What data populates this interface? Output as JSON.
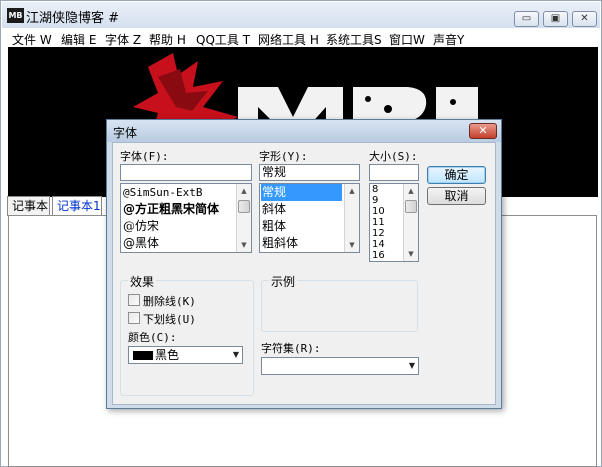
{
  "window": {
    "title": "江湖侠隐博客 #",
    "icon_label": "MB"
  },
  "menu": {
    "items": [
      {
        "label": "文件 W"
      },
      {
        "label": "编辑 E"
      },
      {
        "label": "字体 Z"
      },
      {
        "label": "帮助 H"
      },
      {
        "label": "QQ工具 T"
      },
      {
        "label": "网络工具 H"
      },
      {
        "label": "系统工具S"
      },
      {
        "label": "窗口W"
      },
      {
        "label": "声音Y"
      }
    ]
  },
  "tabs": [
    {
      "label": "记事本"
    },
    {
      "label": "记事本1",
      "active": true
    }
  ],
  "dialog": {
    "title": "字体",
    "font_label": "字体(F):",
    "font_value": "",
    "font_list": [
      "@SimSun-ExtB",
      "@方正粗黑宋简体",
      "@仿宋",
      "@黑体"
    ],
    "style_label": "字形(Y):",
    "style_value": "常规",
    "style_list": [
      "常规",
      "斜体",
      "粗体",
      "粗斜体"
    ],
    "style_selected": "常规",
    "size_label": "大小(S):",
    "size_value": "",
    "size_list": [
      "8",
      "9",
      "10",
      "11",
      "12",
      "14",
      "16"
    ],
    "ok_label": "确定",
    "cancel_label": "取消",
    "effects_title": "效果",
    "strikeout_label": "删除线(K)",
    "underline_label": "下划线(U)",
    "color_label": "颜色(C):",
    "color_value": "黑色",
    "color_swatch": "#000000",
    "sample_title": "示例",
    "charset_label": "字符集(R):",
    "charset_value": ""
  },
  "colors": {
    "selection": "#3399ff",
    "title_bar": "#d4dfee",
    "banner_red": "#c8101c"
  }
}
